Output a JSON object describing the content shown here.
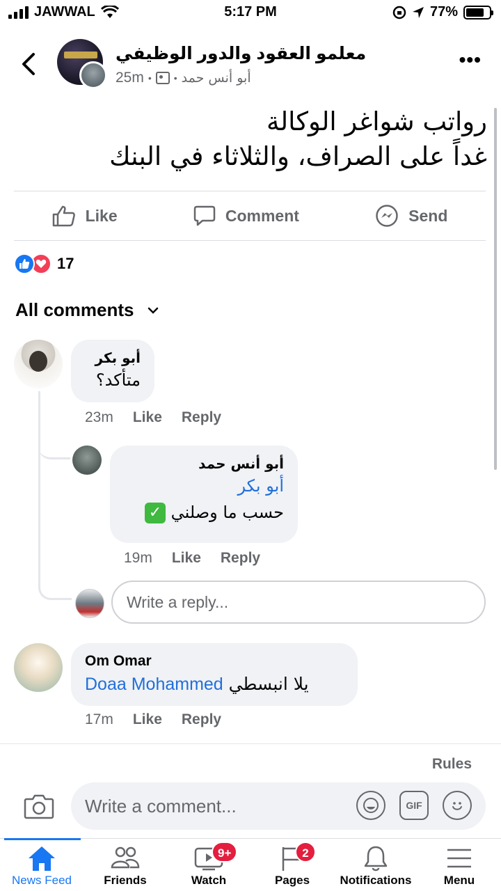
{
  "status_bar": {
    "carrier": "JAWWAL",
    "time": "5:17 PM",
    "battery": "77%",
    "battery_level": 0.77
  },
  "header": {
    "group_name": "معلمو العقود والدور الوظيفي",
    "time_ago": "25m",
    "author": "أبو أنس حمد"
  },
  "post": {
    "line1": "رواتب شواغر الوكالة",
    "line2": "غداً على الصراف، والثلاثاء في البنك"
  },
  "actions": {
    "like": "Like",
    "comment": "Comment",
    "send": "Send"
  },
  "reactions": {
    "count": "17"
  },
  "comments_header": {
    "label": "All comments"
  },
  "comments": [
    {
      "author": "أبو بكر",
      "text": "متأكد؟",
      "time": "23m",
      "like": "Like",
      "reply": "Reply"
    },
    {
      "author": "أبو أنس حمد",
      "mention": "أبو بكر",
      "text": "حسب ما وصلني",
      "time": "19m",
      "like": "Like",
      "reply": "Reply"
    },
    {
      "author": "Om Omar",
      "mention": "Doaa Mohammed",
      "text": "يلا انبسطي",
      "time": "17m",
      "like": "Like",
      "reply": "Reply"
    }
  ],
  "reply_input": {
    "placeholder": "Write a reply..."
  },
  "rules": "Rules",
  "comment_input": {
    "placeholder": "Write a comment..."
  },
  "composer_icons": {
    "gif": "GIF"
  },
  "bottom_nav": [
    {
      "label": "News Feed"
    },
    {
      "label": "Friends"
    },
    {
      "label": "Watch",
      "badge": "9+"
    },
    {
      "label": "Pages",
      "badge": "2"
    },
    {
      "label": "Notifications"
    },
    {
      "label": "Menu"
    }
  ]
}
